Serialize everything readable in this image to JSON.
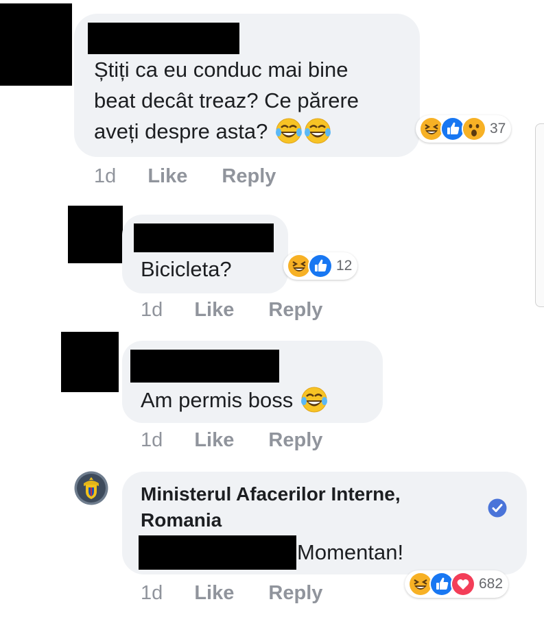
{
  "comments": [
    {
      "text_line1": "Știți ca eu conduc mai bine",
      "text_line2": "beat decât treaz? Ce părere",
      "text_line3": "aveți despre asta?",
      "inline_emoji": [
        "tears-of-joy-emoji",
        "tears-of-joy-emoji"
      ],
      "time": "1d",
      "like": "Like",
      "reply": "Reply",
      "reactions": [
        "haha-icon",
        "like-icon",
        "wow-icon"
      ],
      "reaction_count": "37"
    },
    {
      "text": "Bicicleta?",
      "time": "1d",
      "like": "Like",
      "reply": "Reply",
      "reactions": [
        "haha-icon",
        "like-icon"
      ],
      "reaction_count": "12"
    },
    {
      "text": "Am permis boss",
      "inline_emoji": [
        "tears-of-joy-emoji"
      ],
      "time": "1d",
      "like": "Like",
      "reply": "Reply"
    },
    {
      "author_line1": "Ministerul Afacerilor Interne,",
      "author_line2": "Romania",
      "verified_icon": "verified-badge-icon",
      "text": "Momentan!",
      "time": "1d",
      "like": "Like",
      "reply": "Reply",
      "reactions": [
        "haha-icon",
        "like-icon",
        "love-icon"
      ],
      "reaction_count": "682"
    }
  ],
  "colors": {
    "bubble": "#f0f2f5",
    "meta_text": "#90949c",
    "like_blue": "#1877f2",
    "love_red": "#f33e58",
    "haha_yellow": "#f7b125",
    "verified_blue": "#4a74d9"
  }
}
